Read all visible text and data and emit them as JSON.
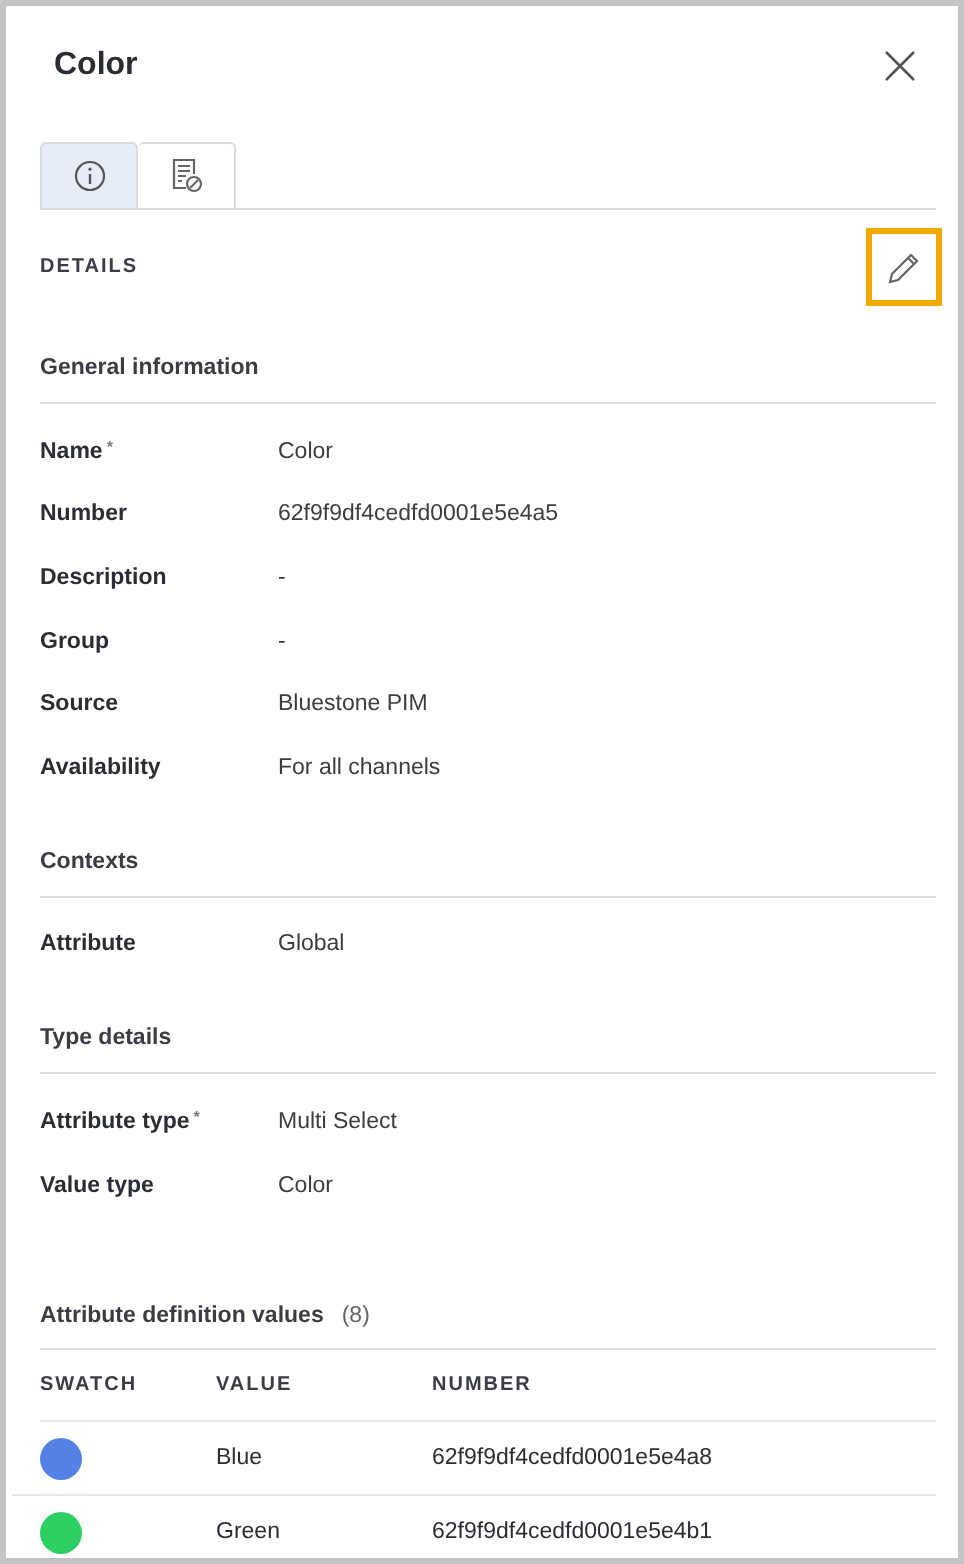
{
  "panel": {
    "title": "Color"
  },
  "tabs": [
    {
      "kind": "info",
      "selected": true
    },
    {
      "kind": "document",
      "selected": false
    }
  ],
  "details": {
    "heading": "DETAILS"
  },
  "sections": [
    {
      "title": "General information",
      "fields": [
        {
          "label": "Name",
          "required_mark": "*",
          "value": "Color"
        },
        {
          "label": "Number",
          "value": "62f9f9df4cedfd0001e5e4a5"
        },
        {
          "label": "Description",
          "value": "-"
        },
        {
          "label": "Group",
          "value": "-"
        },
        {
          "label": "Source",
          "value": "Bluestone PIM"
        },
        {
          "label": "Availability",
          "value": "For all channels"
        }
      ]
    },
    {
      "title": "Contexts",
      "fields": [
        {
          "label": "Attribute",
          "value": "Global"
        }
      ]
    },
    {
      "title": "Type details",
      "fields": [
        {
          "label": "Attribute type",
          "required_mark": "*",
          "value": "Multi Select"
        },
        {
          "label": "Value type",
          "value": "Color"
        }
      ]
    }
  ],
  "values_table": {
    "title": "Attribute definition values",
    "count": "(8)",
    "columns": [
      "SWATCH",
      "VALUE",
      "NUMBER"
    ],
    "rows": [
      {
        "color": "#5581e6",
        "value": "Blue",
        "number": "62f9f9df4cedfd0001e5e4a8"
      },
      {
        "color": "#2ecf62",
        "value": "Green",
        "number": "62f9f9df4cedfd0001e5e4b1"
      }
    ]
  }
}
